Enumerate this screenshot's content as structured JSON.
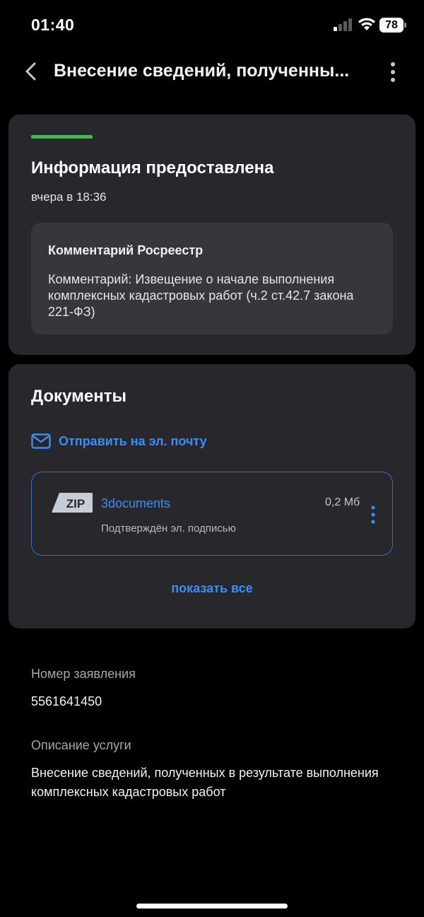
{
  "status_bar": {
    "time": "01:40",
    "battery": "78"
  },
  "header": {
    "title": "Внесение сведений, полученны..."
  },
  "status_card": {
    "title": "Информация предоставлена",
    "time": "вчера в 18:36",
    "accent_color": "#2fc648",
    "comment": {
      "title": "Комментарий Росреестр",
      "text": "Комментарий: Извещение о начале выполнения комплексных кадастровых работ (ч.2 ст.42.7 закона 221-ФЗ)"
    }
  },
  "documents": {
    "title": "Документы",
    "send_email_label": "Отправить на эл. почту",
    "files": [
      {
        "type": "ZIP",
        "name": "3documents",
        "size": "0,2 Мб",
        "signature": "Подтверждён эл. подписью"
      }
    ],
    "show_all_label": "показать все"
  },
  "details": {
    "application_number_label": "Номер заявления",
    "application_number": "5561641450",
    "service_description_label": "Описание услуги",
    "service_description": "Внесение сведений, полученных в результате выполнения комплексных кадастровых работ"
  },
  "colors": {
    "link": "#3a8ef5",
    "card": "#28282c",
    "background": "#000000"
  }
}
